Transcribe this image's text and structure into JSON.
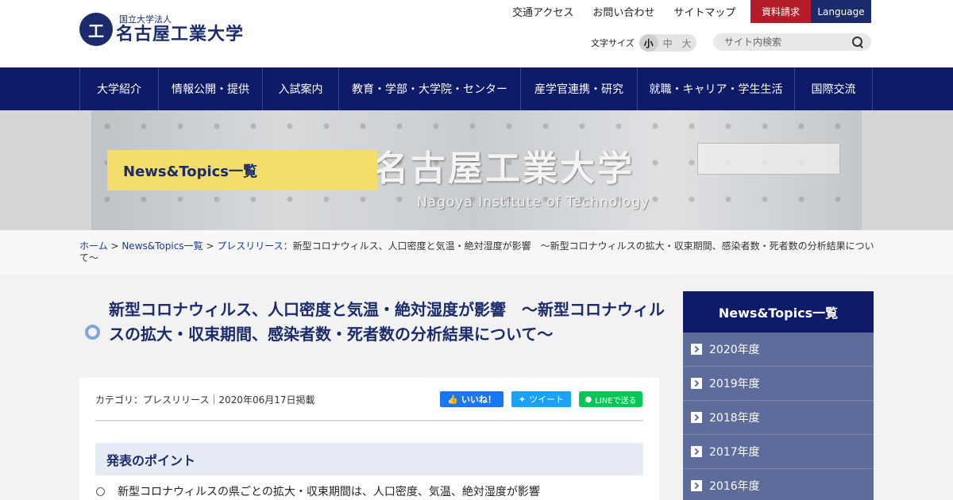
{
  "logo": {
    "sub": "国立大学法人",
    "main": "名古屋工業大学",
    "mark": "工"
  },
  "top_links": [
    "交通アクセス",
    "お問い合わせ",
    "サイトマップ"
  ],
  "buttons": {
    "shiryo": "資料請求",
    "language": "Language"
  },
  "font_size": {
    "label": "文字サイズ",
    "options": [
      "小",
      "中",
      "大"
    ],
    "selected": "小"
  },
  "search": {
    "placeholder": "サイト内検索"
  },
  "nav": [
    "大学紹介",
    "情報公開・提供",
    "入試案内",
    "教育・学部・大学院・センター",
    "産学官連携・研究",
    "就職・キャリア・学生生活",
    "国際交流"
  ],
  "hero": {
    "banner": "News&Topics一覧",
    "title_jp": "名古屋工業大学",
    "title_en": "Nagoya Institute of Technology"
  },
  "breadcrumb": {
    "home": "ホーム",
    "sep": " > ",
    "news": "News&Topics一覧",
    "category": "プレスリリース",
    "current": "：新型コロナウィルス、人口密度と気温・絶対湿度が影響　～新型コロナウィルスの拡大・収束期間、感染者数・死者数の分析結果について～"
  },
  "article": {
    "title": "新型コロナウィルス、人口密度と気温・絶対湿度が影響　～新型コロナウィルスの拡大・収束期間、感染者数・死者数の分析結果について～",
    "meta": "カテゴリ：プレスリリース｜2020年06月17日掲載",
    "share": {
      "fb": "いいね！",
      "tw": "ツイート",
      "line": "LINEで送る"
    },
    "points_heading": "発表のポイント",
    "points": [
      "新型コロナウィルスの県ごとの拡大・収束期間は、人口密度、気温、絶対湿度が影響"
    ]
  },
  "sidebar": {
    "heading": "News&Topics一覧",
    "years": [
      "2020年度",
      "2019年度",
      "2018年度",
      "2017年度",
      "2016年度"
    ]
  },
  "colors": {
    "navy": "#0d1b68",
    "red": "#b41d27",
    "yellow": "#f5dd6b",
    "sidebar": "#5e6c9c"
  }
}
